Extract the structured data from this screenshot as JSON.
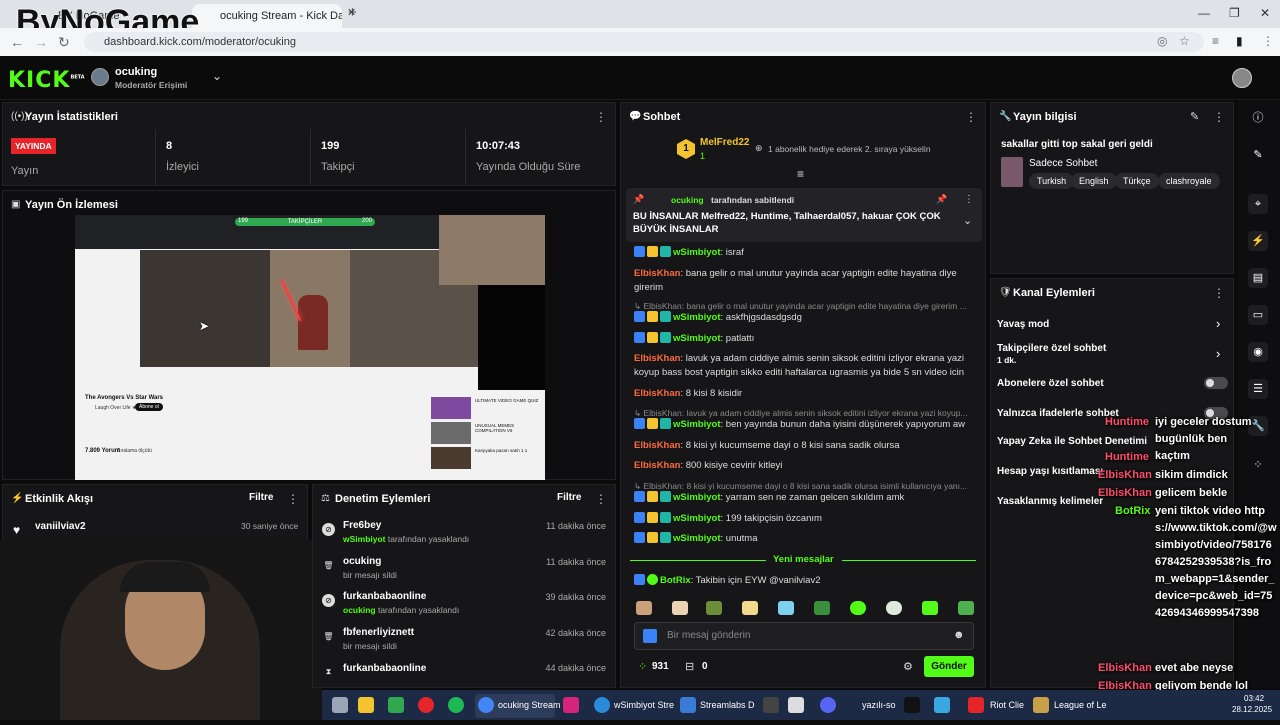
{
  "browser": {
    "tabs": [
      {
        "label": "BY NoGame"
      },
      {
        "label": "ocuking Stream - Kick Dashboa"
      }
    ],
    "new_tab": "+",
    "url": "dashboard.kick.com/moderator/ocuking"
  },
  "watermark": "ByNoGame",
  "header": {
    "logo": "KICK",
    "logo_badge": "BETA",
    "channel_name": "ocuking",
    "channel_role": "Moderatör Erişimi"
  },
  "stats": {
    "title": "Yayın İstatistikleri",
    "live_badge": "YAYINDA",
    "live_label": "Yayın",
    "viewers_value": "8",
    "viewers_label": "İzleyici",
    "followers_value": "199",
    "followers_label": "Takipçi",
    "uptime_value": "10:07:43",
    "uptime_label": "Yayında Olduğu Süre"
  },
  "preview": {
    "title": "Yayın Ön İzlemesi",
    "followers_bar_left": "199",
    "followers_bar_center": "TAKİPÇİLER",
    "followers_bar_right": "200",
    "video_title": "The Avongers Vs Star Wars",
    "channel": "Laugh Over Life ★",
    "subscribe": "Abone ol",
    "comments_count": "7.809 Yorum",
    "sort": "Sıralama ölçütü",
    "side_videos": [
      "ULTIMATE VIDEO GAME QUIZ",
      "UNUSUAL MEMES COMPILATION V6",
      "Karşıyaka pazarı satıh 1 1"
    ]
  },
  "activity": {
    "title": "Etkinlik Akışı",
    "filter": "Filtre",
    "items": [
      {
        "user": "vaniilviav2",
        "time": "30 saniye önce"
      }
    ]
  },
  "mod_actions": {
    "title": "Denetim Eylemleri",
    "filter": "Filtre",
    "items": [
      {
        "user": "Fre6bey",
        "detail": "wSimbiyot tarafından yasaklandı",
        "time": "11 dakika önce"
      },
      {
        "user": "ocuking",
        "detail": "bir mesajı sildi",
        "time": "11 dakika önce"
      },
      {
        "user": "furkanbabaonline",
        "detail": "ocuking tarafından yasaklandı",
        "time": "39 dakika önce"
      },
      {
        "user": "fbfenerliyiznett",
        "detail": "bir mesajı sildi",
        "time": "42 dakika önce"
      },
      {
        "user": "furkanbabaonline",
        "detail": "",
        "time": "44 dakika önce"
      }
    ]
  },
  "chat": {
    "title": "Sohbet",
    "gift_user": "MelFred22",
    "gift_count": "1",
    "gift_text": "1 abonelik hediye ederek 2. sıraya yükselin",
    "pinned_by": "ocuking",
    "pinned_suffix": "tarafından sabitlendi",
    "pinned_text": "BU İNSANLAR Melfred22, Huntime, Talhaerdal057, hakuar ÇOK ÇOK BÜYÜK İNSANLAR",
    "messages": [
      {
        "user": "wSimbiyot",
        "text": "israf"
      },
      {
        "user": "ElbisKhan",
        "text": "bana gelir o mal unutur yayinda acar yaptigin edite hayatina diye girerim"
      },
      {
        "reply": "ElbisKhan: bana gelir o mal unutur yayinda acar yaptigin edite hayatina diye girerim ...",
        "user": "wSimbiyot",
        "text": "askfhjgsdasdgsdg"
      },
      {
        "user": "wSimbiyot",
        "text": "patlattı"
      },
      {
        "user": "ElbisKhan",
        "text": "lavuk ya adam ciddiye almis senin siksok editini izliyor ekrana yazi koyup bass bost yaptigin sikko editi haftalarca ugrasmis ya bide 5 sn video icin"
      },
      {
        "user": "ElbisKhan",
        "text": "8 kisi 8 kisidir"
      },
      {
        "reply": "ElbisKhan: lavuk ya adam ciddiye almis senin siksok editini izliyor ekrana yazi koyup...",
        "user": "wSimbiyot",
        "text": "ben yayında bunun daha iyisini düşünerek yapıyorum aw"
      },
      {
        "user": "ElbisKhan",
        "text": "8 kisi yi kucumseme dayi o 8 kisi sana sadik olursa"
      },
      {
        "user": "ElbisKhan",
        "text": "800 kisiye cevirir kitleyi"
      },
      {
        "reply": "ElbisKhan: 8 kisi yi kucumseme dayi o 8 kisi sana sadik olursa isimli kullanıcıya yanı...",
        "user": "wSimbiyot",
        "text": "yarram sen ne zaman gelcen sıkıldım amk"
      },
      {
        "user": "wSimbiyot",
        "text": "199 takipçisin özcanım"
      },
      {
        "user": "wSimbiyot",
        "text": "unutma"
      }
    ],
    "new_messages": "Yeni mesajlar",
    "bot_message": {
      "user": "BotRix",
      "text": "Takibin için EYW @vanilviav2"
    },
    "input_placeholder": "Bir mesaj gönderin",
    "points": "931",
    "drops": "0",
    "send": "Gönder"
  },
  "stream_info": {
    "title": "Yayın bilgisi",
    "stream_title": "sakallar gitti top sakal geri geldi",
    "category": "Sadece Sohbet",
    "tags": [
      "Turkish",
      "English",
      "Türkçe",
      "clashroyale"
    ]
  },
  "channel_actions": {
    "title": "Kanal Eylemleri",
    "items": [
      {
        "label": "Yavaş mod"
      },
      {
        "label": "Takipçilere özel sohbet",
        "sub": "1 dk."
      },
      {
        "label": "Abonelere özel sohbet"
      },
      {
        "label": "Yalnızca ifadelerle sohbet"
      },
      {
        "label": "Yapay Zeka ile Sohbet Denetimi"
      },
      {
        "label": "Hesap yaşı kısıtlaması"
      },
      {
        "label": "Yasaklanmış kelimeler"
      }
    ]
  },
  "overlay_chat": [
    {
      "user": "Huntime",
      "text": "iyi geceler dostum bugünlük ben kaçtım"
    },
    {
      "user": "Huntime",
      "text": ""
    },
    {
      "user": "ElbisKhan",
      "text": "sikim dimdick"
    },
    {
      "user": "ElbisKhan",
      "text": "gelicem bekle"
    },
    {
      "user": "BotRix",
      "text": "yeni tiktok video https://www.tiktok.com/@wsimbiyot/video/7581766784252939538?is_from_webapp=1&sender_device=pc&web_id=7542694346999547398"
    },
    {
      "user": "ElbisKhan",
      "text": "evet abe neyse"
    },
    {
      "user": "ElbisKhan",
      "text": "geliyom bende lol gacak"
    }
  ],
  "taskbar": {
    "items": [
      "ocuking Stream",
      "wSimbiyot Stre",
      "Streamlabs D",
      "yazılı-so",
      "Riot Clie",
      "League of Le"
    ],
    "time": "03:42",
    "date": "28.12.2025"
  },
  "colors": {
    "kick_green": "#53fc18",
    "live_red": "#e5252a",
    "elbis": "#ff6a3d",
    "simbiyot": "#53fc18",
    "huntime_overlay": "#ff4d6d"
  }
}
